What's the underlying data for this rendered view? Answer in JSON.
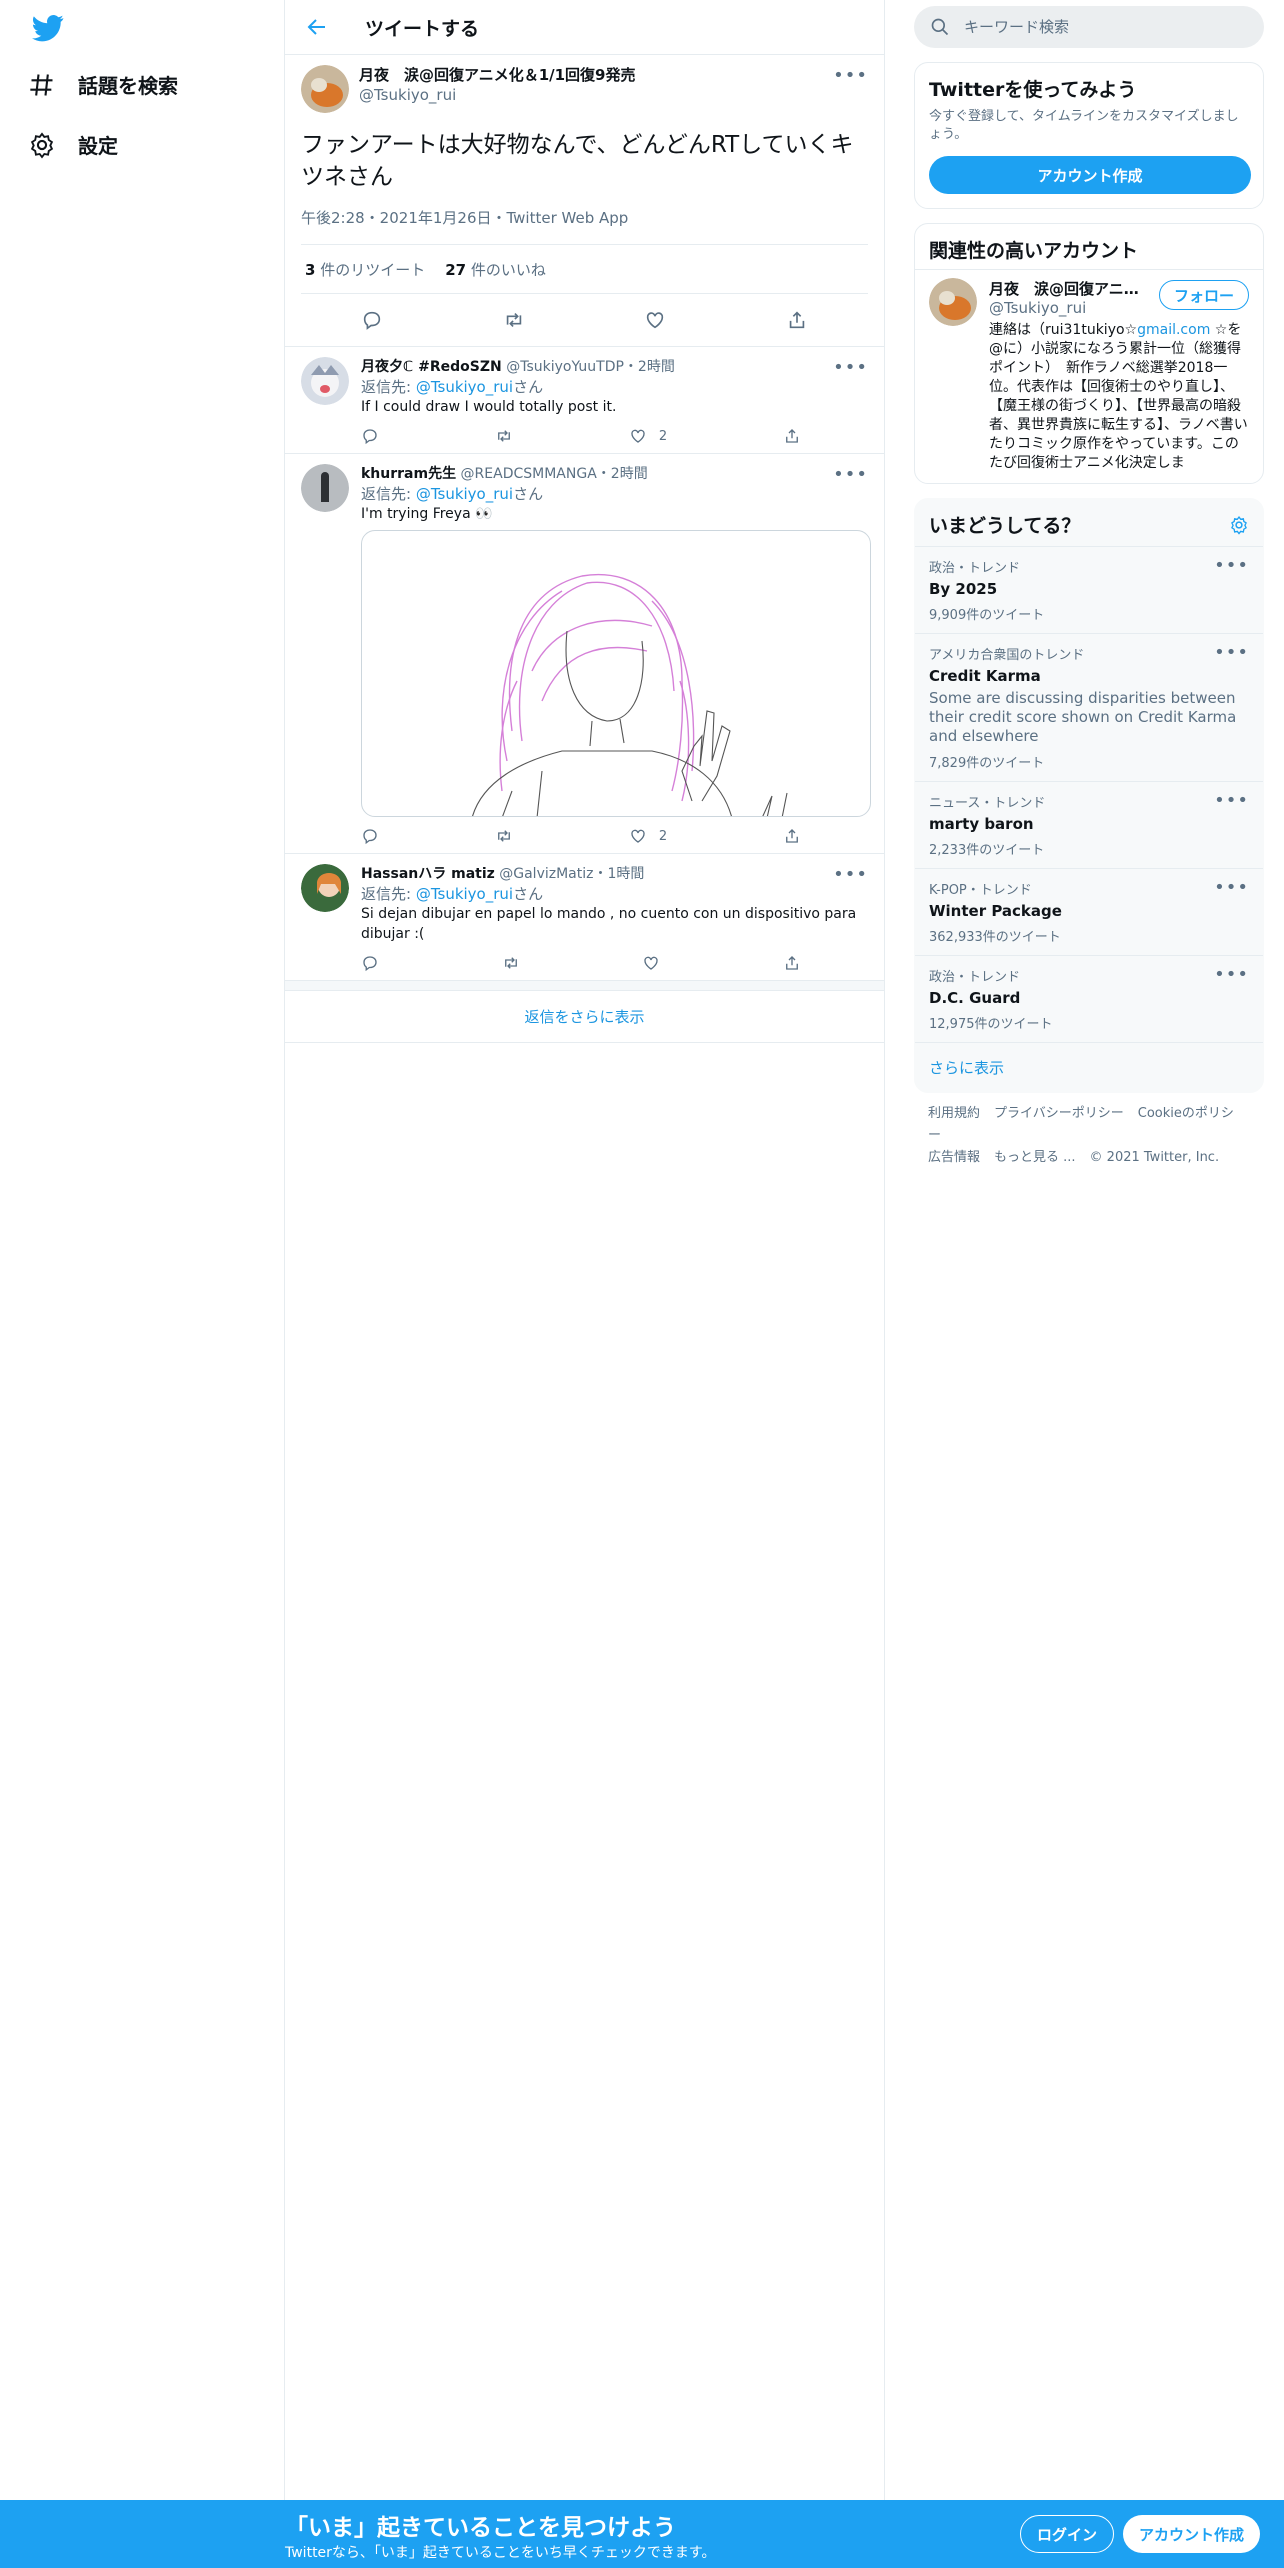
{
  "nav": {
    "search_label": "話題を検索",
    "settings_label": "設定"
  },
  "header": {
    "title": "ツイートする"
  },
  "focal": {
    "name": "月夜　涙@回復アニメ化＆1/1回復9発売",
    "handle": "@Tsukiyo_rui",
    "text": "ファンアートは大好物なんで、どんどんRTしていくキツネさん",
    "meta": "午後2:28・2021年1月26日・Twitter Web App",
    "retweets_count": "3",
    "retweets_label": "件のリツイート",
    "likes_count": "27",
    "likes_label": "件のいいね"
  },
  "replies": [
    {
      "name": "月夜夕ℂ #RedoSZN",
      "handle": "@TsukiyoYuuTDP",
      "time": "・2時間",
      "reply_prefix": "返信先: ",
      "reply_to": "@Tsukiyo_rui",
      "reply_suffix": "さん",
      "text": "If I could draw I would totally post it.",
      "likes": "2"
    },
    {
      "name": "khurram先生",
      "handle": "@READCSMMANGA",
      "time": "・2時間",
      "reply_prefix": "返信先: ",
      "reply_to": "@Tsukiyo_rui",
      "reply_suffix": "さん",
      "text": "I'm trying Freya 👀",
      "likes": "2"
    },
    {
      "name": "Hassanハラ matiz",
      "handle": "@GalvizMatiz",
      "time": "・1時間",
      "reply_prefix": "返信先: ",
      "reply_to": "@Tsukiyo_rui",
      "reply_suffix": "さん",
      "text": "Si  dejan dibujar en papel lo mando , no cuento con un dispositivo para dibujar :(",
      "likes": ""
    }
  ],
  "show_more_replies": "返信をさらに表示",
  "search": {
    "placeholder": "キーワード検索"
  },
  "signup_box": {
    "title": "Twitterを使ってみよう",
    "subtitle": "今すぐ登録して、タイムラインをカスタマイズしましょう。",
    "button": "アカウント作成"
  },
  "related": {
    "title": "関連性の高いアカウント",
    "name": "月夜　涙@回復アニ...",
    "handle": "@Tsukiyo_rui",
    "follow": "フォロー",
    "bio_pre": "連絡は（rui31tukiyo☆",
    "bio_link": "gmail.com",
    "bio_post": " ☆を@に）小説家になろう累計一位（総獲得ポイント）　新作ラノベ総選挙2018一位。代表作は【回復術士のやり直し】、【魔王様の街づくり】、【世界最高の暗殺者、異世界貴族に転生する】、ラノベ書いたりコミック原作をやっています。このたび回復術士アニメ化決定しま"
  },
  "trends": {
    "title": "いまどうしてる？",
    "items": [
      {
        "meta": "政治・トレンド",
        "name": "By 2025",
        "desc": "",
        "count": "9,909件のツイート"
      },
      {
        "meta": "アメリカ合衆国のトレンド",
        "name": "Credit Karma",
        "desc": "Some are discussing disparities between their credit score shown on Credit Karma and elsewhere",
        "count": "7,829件のツイート"
      },
      {
        "meta": "ニュース・トレンド",
        "name": "marty baron",
        "desc": "",
        "count": "2,233件のツイート"
      },
      {
        "meta": "K-POP・トレンド",
        "name": "Winter Package",
        "desc": "",
        "count": "362,933件のツイート"
      },
      {
        "meta": "政治・トレンド",
        "name": "D.C. Guard",
        "desc": "",
        "count": "12,975件のツイート"
      }
    ],
    "more": "さらに表示"
  },
  "footer": {
    "links": [
      "利用規約",
      "プライバシーポリシー",
      "Cookieのポリシー",
      "広告情報",
      "もっと見る ..."
    ],
    "copyright": "© 2021 Twitter, Inc."
  },
  "bottombar": {
    "title": "「いま」起きていることを見つけよう",
    "subtitle": "Twitterなら、「いま」起きていることをいち早くチェックできます。",
    "login": "ログイン",
    "signup": "アカウント作成"
  },
  "colors": {
    "accent": "#1da1f2",
    "link": "#1b95e0",
    "muted": "#5b7083"
  }
}
